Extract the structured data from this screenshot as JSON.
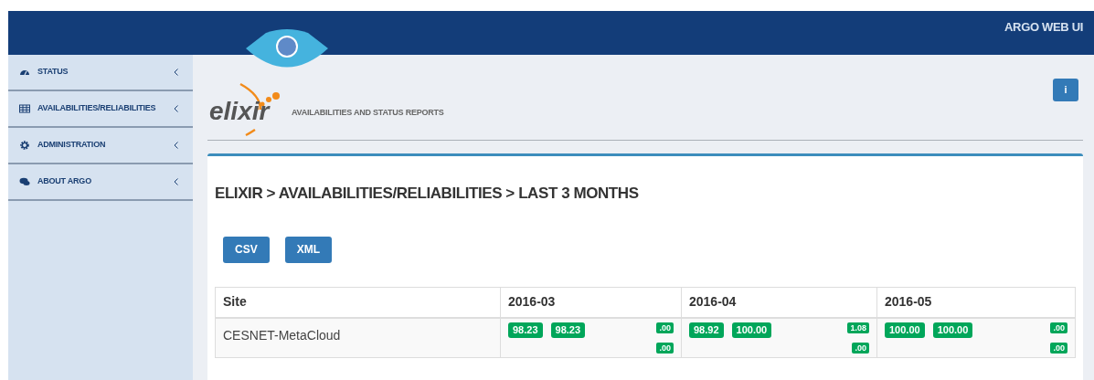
{
  "navbar": {
    "brand": "ARGO WEB UI"
  },
  "sidebar": {
    "items": [
      {
        "label": "STATUS",
        "expanded": false
      },
      {
        "label": "AVAILABILITIES/RELIABILITIES",
        "expanded": false
      },
      {
        "label": "ADMINISTRATION",
        "expanded": false
      },
      {
        "label": "ABOUT ARGO",
        "expanded": false
      }
    ]
  },
  "header": {
    "logo_text": "elixir",
    "subtitle": "AVAILABILITIES AND STATUS REPORTS",
    "info_button": "i"
  },
  "page": {
    "title": "ELIXIR > AVAILABILITIES/RELIABILITIES > LAST 3 MONTHS",
    "buttons": [
      "CSV",
      "XML"
    ]
  },
  "table": {
    "columns": [
      "Site",
      "2016-03",
      "2016-04",
      "2016-05"
    ],
    "rows": [
      {
        "cells": [
          {
            "text": "CESNET-MetaCloud"
          },
          {
            "main": [
              "98.23",
              "98.23"
            ],
            "side": [
              ".00",
              ".00"
            ]
          },
          {
            "main": [
              "98.92",
              "100.00"
            ],
            "side": [
              "1.08",
              ".00"
            ]
          },
          {
            "main": [
              "100.00",
              "100.00"
            ],
            "side": [
              ".00",
              ".00"
            ]
          }
        ]
      }
    ]
  }
}
